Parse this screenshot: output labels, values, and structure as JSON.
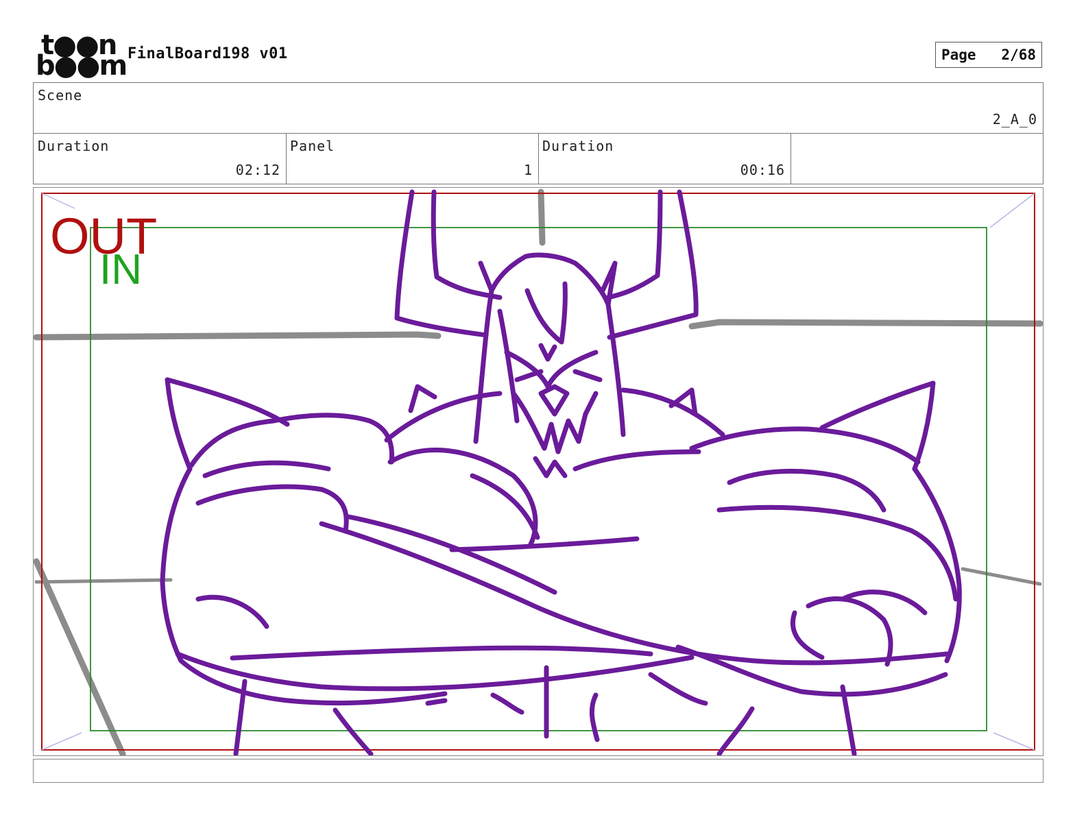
{
  "header": {
    "logo_line1": "t●●n",
    "logo_line2": "b●●m",
    "document_title": "FinalBoard198 v01",
    "page_label": "Page",
    "page_number": "2/68"
  },
  "scene": {
    "label": "Scene",
    "value": "2_A_0"
  },
  "info_row": [
    {
      "label": "Duration",
      "value": "02:12"
    },
    {
      "label": "Panel",
      "value": "1"
    },
    {
      "label": "Duration",
      "value": "00:16"
    },
    {
      "label": "",
      "value": ""
    }
  ],
  "panel": {
    "out_label": "OUT",
    "in_label": "IN",
    "colors": {
      "out_frame": "#b01010",
      "in_frame": "#2a8a2a",
      "sketch": "#6a1b9a",
      "background_lines": "#8c8c8c"
    }
  },
  "caption": ""
}
